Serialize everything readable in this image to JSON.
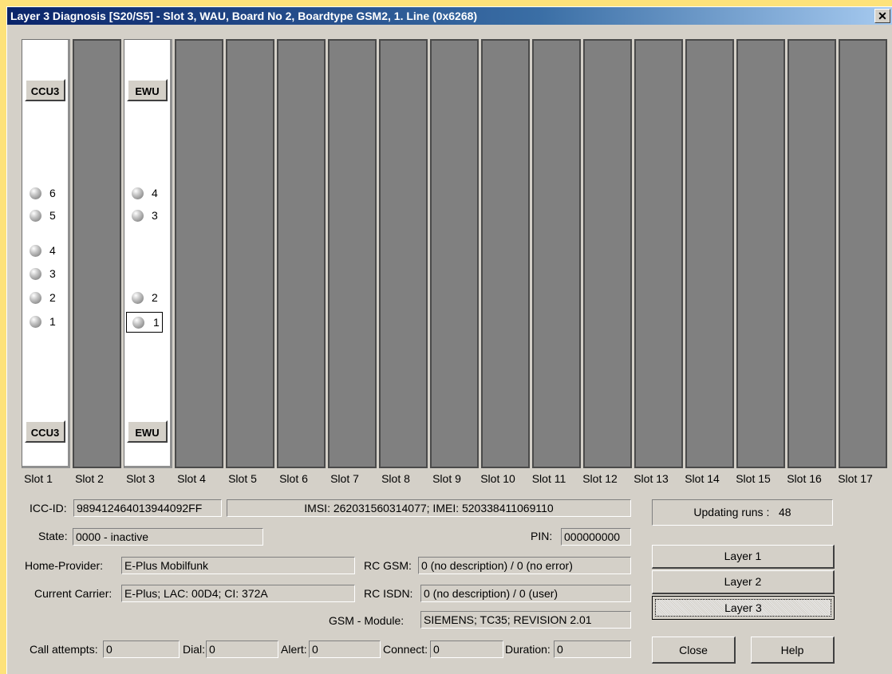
{
  "window": {
    "title": "Layer 3 Diagnosis [S20/S5] - Slot 3, WAU, Board No 2, Boardtype GSM2,  1. Line (0x6268)",
    "close_glyph": "✕"
  },
  "rack": {
    "slot1": {
      "card_top": "CCU3",
      "card_bottom": "CCU3",
      "leds": [
        "6",
        "5",
        "4",
        "3",
        "2",
        "1"
      ]
    },
    "slot3": {
      "card_top": "EWU",
      "card_bottom": "EWU",
      "leds": [
        "4",
        "3",
        "2",
        "1"
      ],
      "selected_led": "1"
    },
    "slot_labels": [
      "Slot 1",
      "Slot 2",
      "Slot 3",
      "Slot 4",
      "Slot 5",
      "Slot 6",
      "Slot 7",
      "Slot 8",
      "Slot 9",
      "Slot 10",
      "Slot 11",
      "Slot 12",
      "Slot 13",
      "Slot 14",
      "Slot 15",
      "Slot 16",
      "Slot 17"
    ]
  },
  "info": {
    "icc_label": "ICC-ID:",
    "icc_value": "989412464013944092FF",
    "imsi_imei": "IMSI: 262031560314077; IMEI: 520338411069110",
    "state_label": "State:",
    "state_value": "0000 - inactive",
    "pin_label": "PIN:",
    "pin_value": "000000000",
    "home_provider_label": "Home-Provider:",
    "home_provider_value": "E-Plus Mobilfunk",
    "current_carrier_label": "Current Carrier:",
    "current_carrier_value": "E-Plus; LAC: 00D4; CI: 372A",
    "rc_gsm_label": "RC GSM:",
    "rc_gsm_value": "0 (no description) / 0 (no error)",
    "rc_isdn_label": "RC ISDN:",
    "rc_isdn_value": "0 (no description) / 0 (user)",
    "gsm_module_label": "GSM - Module:",
    "gsm_module_value": "SIEMENS; TC35; REVISION 2.01"
  },
  "stats": {
    "call_attempts_label": "Call attempts:",
    "call_attempts_value": "0",
    "dial_label": "Dial:",
    "dial_value": "0",
    "alert_label": "Alert:",
    "alert_value": "0",
    "connect_label": "Connect:",
    "connect_value": "0",
    "duration_label": "Duration:",
    "duration_value": "0"
  },
  "updating": {
    "label": "Updating runs :",
    "value": "48"
  },
  "buttons": {
    "layer1": "Layer 1",
    "layer2": "Layer 2",
    "layer3": "Layer 3",
    "close": "Close",
    "help": "Help"
  },
  "colors": {
    "title_start": "#0a246a",
    "dialog_bg": "#d4d0c8",
    "empty_slot": "#808080",
    "desktop": "#fde27a"
  }
}
